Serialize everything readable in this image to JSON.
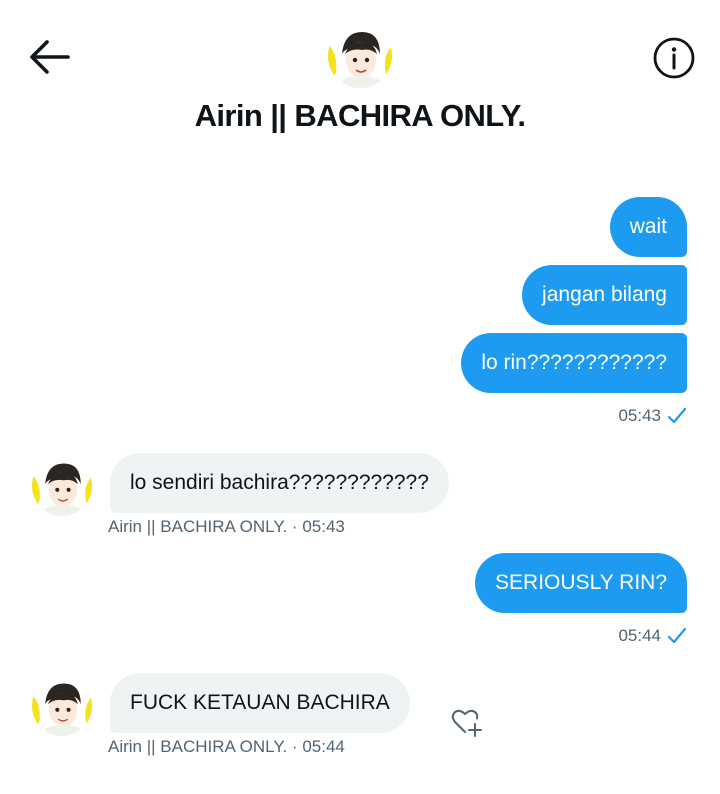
{
  "header": {
    "title": "Airin || BACHIRA ONLY."
  },
  "messages": [
    {
      "direction": "out",
      "text": "wait"
    },
    {
      "direction": "out",
      "text": "jangan bilang"
    },
    {
      "direction": "out",
      "text": "lo rin????????????"
    },
    {
      "direction": "out_meta",
      "time": "05:43"
    },
    {
      "direction": "in",
      "text": "lo sendiri bachira????????????",
      "sender": "Airin || BACHIRA ONLY.",
      "time": "05:43"
    },
    {
      "direction": "out",
      "text": "SERIOUSLY RIN?"
    },
    {
      "direction": "out_meta",
      "time": "05:44"
    },
    {
      "direction": "in",
      "text": "FUCK KETAUAN BACHIRA",
      "sender": "Airin || BACHIRA ONLY.",
      "time": "05:44"
    }
  ],
  "meta": {
    "in1": "Airin || BACHIRA ONLY. · 05:43",
    "in2": "Airin || BACHIRA ONLY. · 05:44"
  },
  "colors": {
    "accent": "#1d9bf0",
    "incoming_bg": "#eff3f4",
    "muted": "#536471",
    "avatar_yellow": "#f4e21c"
  }
}
